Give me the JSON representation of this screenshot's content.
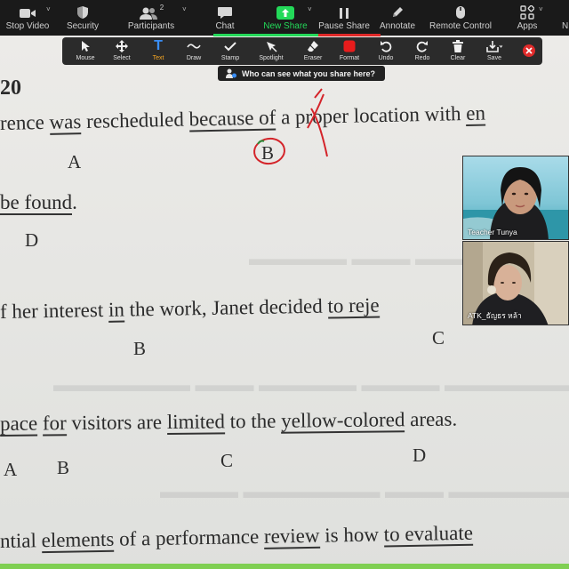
{
  "toolbar": {
    "items": [
      {
        "label": "Stop Video",
        "icon": "video-camera-icon"
      },
      {
        "label": "Security",
        "icon": "shield-icon"
      },
      {
        "label": "Participants",
        "icon": "participants-icon",
        "count": "2"
      },
      {
        "label": "Chat",
        "icon": "chat-bubble-icon"
      },
      {
        "label": "New Share",
        "icon": "share-arrow-icon"
      },
      {
        "label": "Pause Share",
        "icon": "pause-icon"
      },
      {
        "label": "Annotate",
        "icon": "pencil-icon"
      },
      {
        "label": "Remote Control",
        "icon": "mouse-icon"
      },
      {
        "label": "Apps",
        "icon": "apps-grid-icon"
      }
    ],
    "colors": {
      "share": "#23d959",
      "pause": "#e02828"
    }
  },
  "annotate": {
    "tools": [
      {
        "label": "Mouse",
        "icon": "mouse-pointer-icon"
      },
      {
        "label": "Select",
        "icon": "move-arrows-icon"
      },
      {
        "label": "Text",
        "icon": "text-t-icon"
      },
      {
        "label": "Draw",
        "icon": "draw-wave-icon"
      },
      {
        "label": "Stamp",
        "icon": "checkmark-icon"
      },
      {
        "label": "Spotlight",
        "icon": "spotlight-arrow-icon"
      },
      {
        "label": "Eraser",
        "icon": "eraser-icon"
      },
      {
        "label": "Format",
        "icon": "color-square-icon"
      },
      {
        "label": "Undo",
        "icon": "undo-icon"
      },
      {
        "label": "Redo",
        "icon": "redo-icon"
      },
      {
        "label": "Clear",
        "icon": "trash-icon"
      },
      {
        "label": "Save",
        "icon": "save-download-icon"
      }
    ],
    "active_tool": "Text",
    "colors": {
      "text_active": "#f5a623",
      "format": "#e81c1c",
      "close": "#e02b2b"
    }
  },
  "who_can_see": "Who can see what you share here?",
  "document": {
    "number": "20",
    "l1": {
      "a": "rence ",
      "b": "was",
      "c": " rescheduled ",
      "d": "because of",
      "e": " a proper location with ",
      "f": "en"
    },
    "l2": {
      "a": "be found",
      "b": "."
    },
    "l3": {
      "a": "f her interest ",
      "b": "in",
      "c": " the work, Janet decided ",
      "d": "to reje"
    },
    "l4": {
      "a": "pace",
      "b": " ",
      "c": "for",
      "d": " visitors are ",
      "e": "limited",
      "f": " to the ",
      "g": "yellow-colored",
      "h": " areas."
    },
    "l5": {
      "a": "ntial ",
      "b": "elements",
      "c": " of a performance ",
      "d": "review",
      "e": " is how ",
      "f": "to evaluate"
    },
    "letters": {
      "a1": "A",
      "b1": "B",
      "d2": "D",
      "b3": "B",
      "c3": "C",
      "a4": "A",
      "b4": "B",
      "c4": "C",
      "d4": "D"
    },
    "annotation_color": "#d4242a"
  },
  "participants": [
    {
      "name": "Teacher Tunya"
    },
    {
      "name": "ATK_ธัญธร หล้า"
    }
  ]
}
